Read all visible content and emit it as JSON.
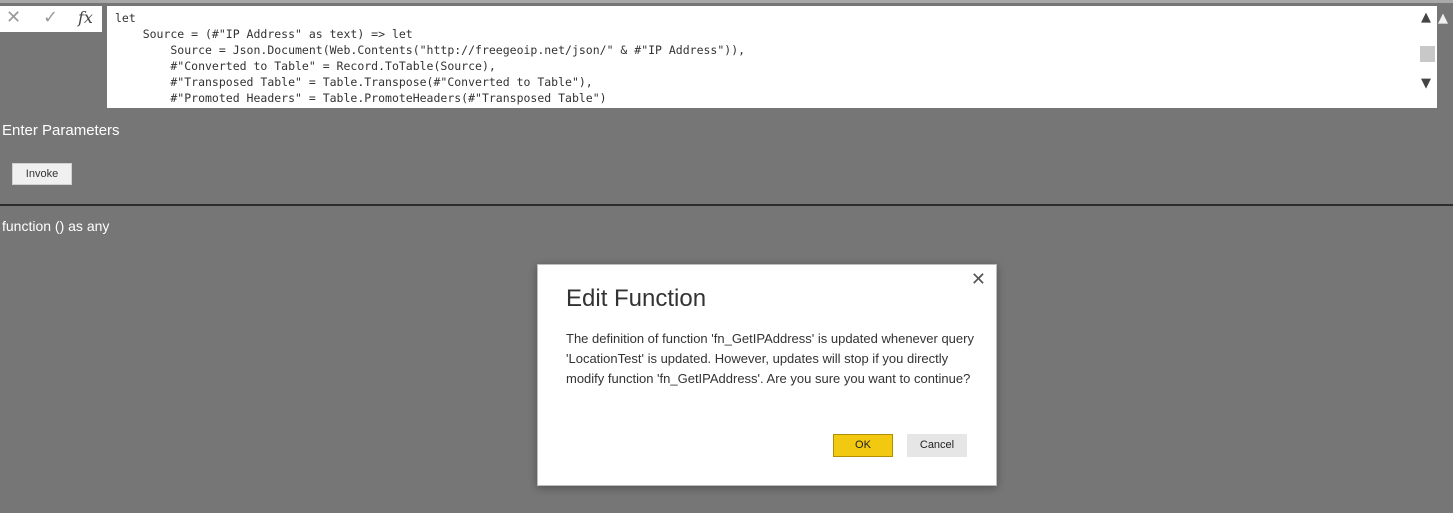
{
  "formula_bar": {
    "cancel_icon": "close-icon",
    "commit_icon": "check-icon",
    "fx_label": "fx",
    "code_lines": [
      "let",
      "    Source = (#\"IP Address\" as text) => let",
      "        Source = Json.Document(Web.Contents(\"http://freegeoip.net/json/\" & #\"IP Address\")),",
      "        #\"Converted to Table\" = Record.ToTable(Source),",
      "        #\"Transposed Table\" = Table.Transpose(#\"Converted to Table\"),",
      "        #\"Promoted Headers\" = Table.PromoteHeaders(#\"Transposed Table\")"
    ]
  },
  "parameters": {
    "heading": "Enter Parameters",
    "invoke_label": "Invoke"
  },
  "function_signature": "function () as any",
  "dialog": {
    "title": "Edit Function",
    "message": "The definition of function 'fn_GetIPAddress' is updated whenever query 'LocationTest' is updated. However, updates will stop if you directly modify function 'fn_GetIPAddress'. Are you sure you want to continue?",
    "ok_label": "OK",
    "cancel_label": "Cancel"
  },
  "colors": {
    "background": "#767676",
    "ok_button": "#f2c811",
    "divider": "#2c2c2c"
  }
}
